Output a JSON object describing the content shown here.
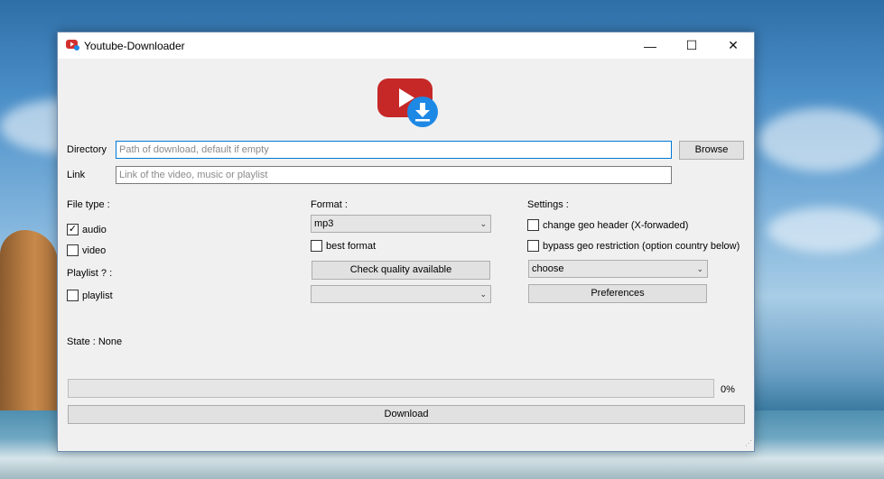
{
  "window": {
    "title": "Youtube-Downloader",
    "minimize_glyph": "—",
    "maximize_glyph": "☐",
    "close_glyph": "✕"
  },
  "fields": {
    "directory_label": "Directory",
    "directory_placeholder": "Path of download, default if empty",
    "directory_value": "",
    "browse_label": "Browse",
    "link_label": "Link",
    "link_placeholder": "Link of the video, music or playlist",
    "link_value": ""
  },
  "file_type": {
    "heading": "File type :",
    "audio_label": "audio",
    "audio_checked": true,
    "video_label": "video",
    "video_checked": false
  },
  "playlist": {
    "heading": "Playlist ? :",
    "playlist_label": "playlist",
    "playlist_checked": false
  },
  "format": {
    "heading": "Format :",
    "selected": "mp3",
    "best_format_label": "best format",
    "best_format_checked": false,
    "check_quality_label": "Check quality available",
    "quality_selected": ""
  },
  "settings": {
    "heading": "Settings :",
    "geo_header_label": "change geo header (X-forwaded)",
    "geo_header_checked": false,
    "bypass_geo_label": "bypass geo restriction (option country below)",
    "bypass_geo_checked": false,
    "country_selected": "choose",
    "preferences_label": "Preferences"
  },
  "state": {
    "text": "State : None"
  },
  "progress": {
    "value": 0,
    "label": "0%"
  },
  "download_label": "Download",
  "icons": {
    "app": "youtube-download-icon",
    "logo": "youtube-download-logo",
    "dropdown": "chevron-down-icon",
    "check": "checkmark-icon",
    "grip": "resize-grip-icon"
  },
  "colors": {
    "window_bg": "#f0f0f0",
    "accent": "#0078d7",
    "youtube_red": "#d32f2f",
    "download_blue": "#1e88e5",
    "progress_fill": "#06b025"
  }
}
